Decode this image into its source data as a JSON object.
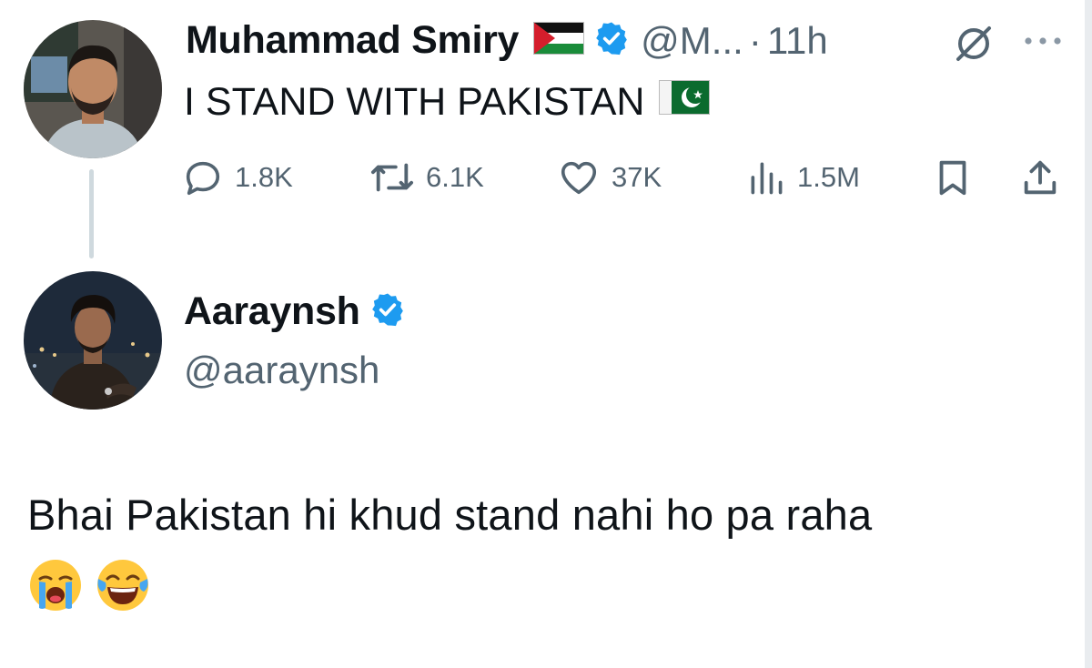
{
  "tweet": {
    "author_name": "Muhammad Smiry",
    "author_handle": "@M...",
    "separator": "·",
    "time": "11h",
    "text": "I STAND WITH PAKISTAN",
    "stats": {
      "replies": "1.8K",
      "reposts": "6.1K",
      "likes": "37K",
      "views": "1.5M"
    }
  },
  "reply": {
    "author_name": "Aaraynsh",
    "author_handle": "@aaraynsh",
    "text": "Bhai Pakistan hi khud stand nahi ho pa raha"
  },
  "colors": {
    "verified": "#1d9bf0",
    "text_primary": "#0f1419",
    "text_secondary": "#536471",
    "thread_line": "#cfd9de"
  },
  "icons": [
    "palestine-flag-icon",
    "verified-badge-icon",
    "grok-icon",
    "more-icon",
    "reply-icon",
    "repost-icon",
    "like-icon",
    "views-icon",
    "bookmark-icon",
    "share-icon",
    "pakistan-flag-icon",
    "loudly-crying-face-icon",
    "tears-of-joy-icon"
  ]
}
